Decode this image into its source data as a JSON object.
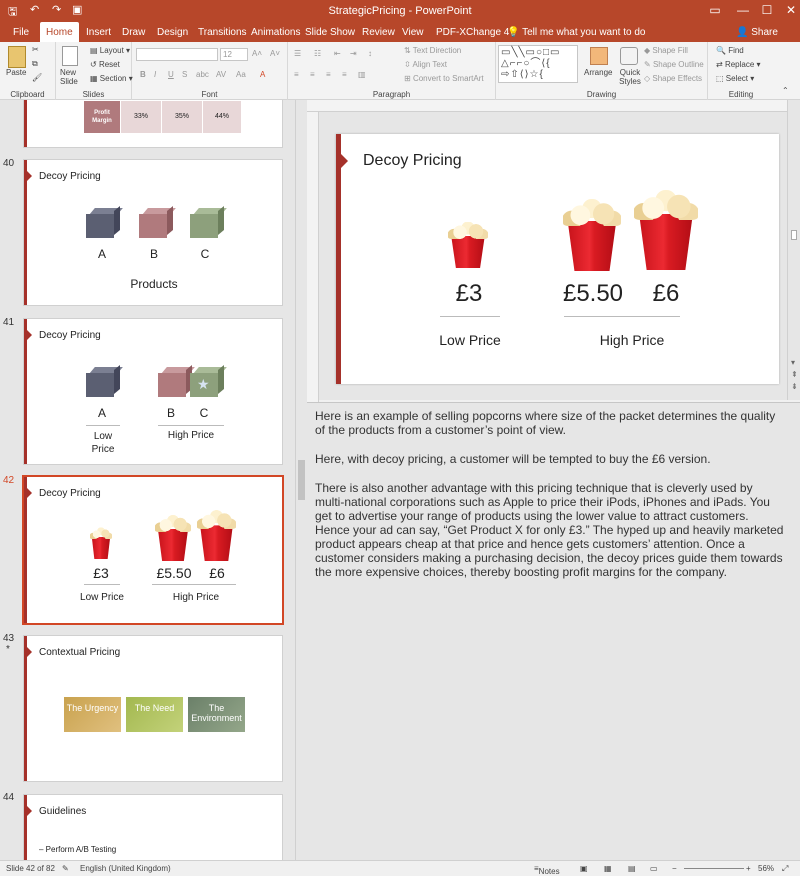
{
  "window": {
    "title": "StrategicPricing  -  PowerPoint",
    "minimize": "—",
    "restore": "☐",
    "close": "✕"
  },
  "quick_access": {
    "save": "🖫",
    "undo": "↶",
    "redo": "↷",
    "present": "▣"
  },
  "tabs": [
    "File",
    "Home",
    "Insert",
    "Draw",
    "Design",
    "Transitions",
    "Animations",
    "Slide Show",
    "Review",
    "View",
    "PDF-XChange 4"
  ],
  "tell_me": "Tell me what you want to do",
  "share": "Share",
  "ribbon": {
    "clipboard": {
      "label": "Clipboard",
      "paste": "Paste"
    },
    "slides": {
      "label": "Slides",
      "new_slide": "New Slide",
      "layout": "Layout",
      "reset": "Reset",
      "section": "Section"
    },
    "font": {
      "label": "Font",
      "size": "12"
    },
    "paragraph": {
      "label": "Paragraph",
      "text_direction": "Text Direction",
      "align_text": "Align Text",
      "convert": "Convert to SmartArt"
    },
    "drawing": {
      "label": "Drawing",
      "arrange": "Arrange",
      "quick_styles": "Quick Styles",
      "shape_fill": "Shape Fill",
      "shape_outline": "Shape Outline",
      "shape_effects": "Shape Effects"
    },
    "editing": {
      "label": "Editing",
      "find": "Find",
      "replace": "Replace",
      "select": "Select"
    }
  },
  "thumbnails": {
    "s39": {
      "profit_margin": "Profit Margin",
      "values": [
        "33%",
        "35%",
        "44%"
      ]
    },
    "s40": {
      "num": "40",
      "title": "Decoy Pricing",
      "labels": [
        "A",
        "B",
        "C"
      ],
      "caption": "Products"
    },
    "s41": {
      "num": "41",
      "title": "Decoy Pricing",
      "a": "A",
      "b": "B",
      "c": "C",
      "low": "Low Price",
      "high": "High Price"
    },
    "s42": {
      "num": "42",
      "title": "Decoy Pricing",
      "p1": "£3",
      "p2": "£5.50",
      "p3": "£6",
      "low": "Low Price",
      "high": "High Price"
    },
    "s43": {
      "num": "43",
      "star": "*",
      "title": "Contextual Pricing",
      "boxes": [
        "The Urgency",
        "The Need",
        "The Environment"
      ]
    },
    "s44": {
      "num": "44",
      "title": "Guidelines",
      "bullet": "– Perform A/B Testing"
    }
  },
  "slide": {
    "title": "Decoy Pricing",
    "p1": "£3",
    "p2": "£5.50",
    "p3": "£6",
    "low": "Low Price",
    "high": "High Price"
  },
  "notes": [
    "Here is an example of selling popcorns where size of the packet determines the quality of the products from a customer’s point of view.",
    "Here, with decoy pricing, a customer will be tempted to buy the £6 version.",
    "There is also another advantage with this pricing technique that is cleverly used by multi-national corporations such as Apple to price their iPods, iPhones and iPads. You get to advertise your range of products using the lower value to attract customers. Hence your ad can say, “Get Product X for only £3.” The hyped up and heavily marketed product appears cheap at that price and hence gets customers’ attention. Once a customer considers making a purchasing decision, the decoy prices guide them towards the more expensive choices, thereby boosting profit margins for the company."
  ],
  "status": {
    "slide": "Slide 42 of 82",
    "language": "English (United Kingdom)",
    "notes": "Notes",
    "zoom": "56%"
  },
  "colors": {
    "accent": "#b7472a",
    "bar": "#a5312a",
    "cubeA": "#5b5f72",
    "cubeB": "#b07a7d",
    "cubeC": "#8da07c"
  }
}
